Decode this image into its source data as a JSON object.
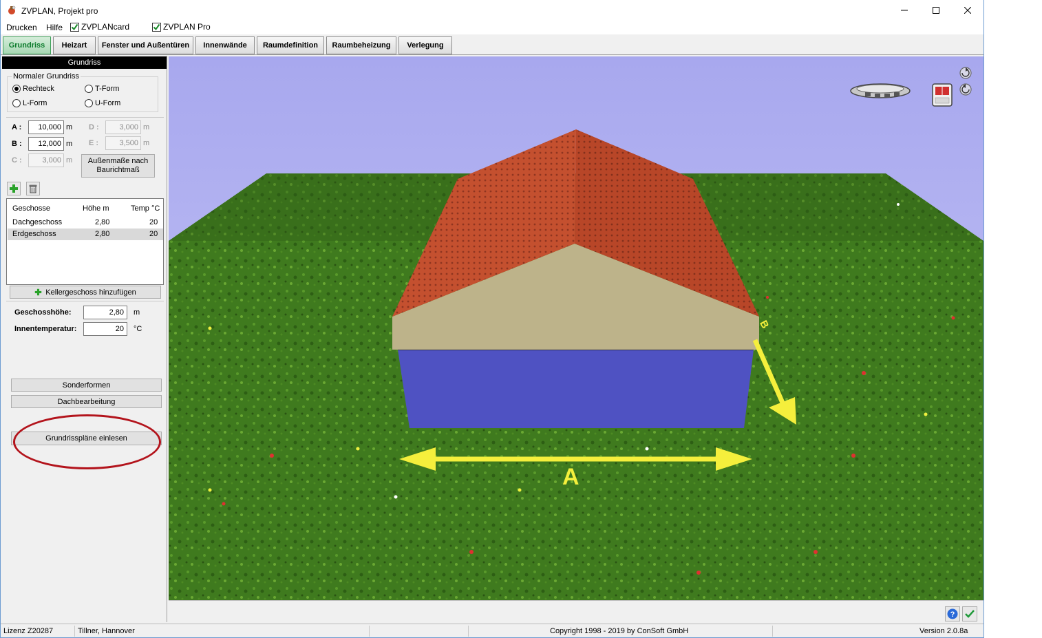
{
  "window": {
    "title": "ZVPLAN, Projekt pro"
  },
  "menu": {
    "items": [
      "Drucken",
      "Hilfe"
    ],
    "checks": [
      {
        "label": "ZVPLANcard",
        "checked": true
      },
      {
        "label": "ZVPLAN Pro",
        "checked": true
      }
    ]
  },
  "tabs": [
    {
      "label": "Grundriss",
      "active": true
    },
    {
      "label": "Heizart",
      "active": false
    },
    {
      "label": "Fenster und Außentüren",
      "active": false
    },
    {
      "label": "Innenwände",
      "active": false
    },
    {
      "label": "Raumdefinition",
      "active": false
    },
    {
      "label": "Raumbeheizung",
      "active": false
    },
    {
      "label": "Verlegung",
      "active": false
    }
  ],
  "panel": {
    "header": "Grundriss",
    "shape_group_label": "Normaler Grundriss",
    "shapes": [
      {
        "label": "Rechteck",
        "selected": true
      },
      {
        "label": "T-Form",
        "selected": false
      },
      {
        "label": "L-Form",
        "selected": false
      },
      {
        "label": "U-Form",
        "selected": false
      }
    ],
    "dimensions": {
      "A": {
        "label": "A :",
        "value": "10,000",
        "unit": "m",
        "enabled": true
      },
      "B": {
        "label": "B :",
        "value": "12,000",
        "unit": "m",
        "enabled": true
      },
      "C": {
        "label": "C :",
        "value": "3,000",
        "unit": "m",
        "enabled": false
      },
      "D": {
        "label": "D :",
        "value": "3,000",
        "unit": "m",
        "enabled": false
      },
      "E": {
        "label": "E :",
        "value": "3,500",
        "unit": "m",
        "enabled": false
      }
    },
    "outer_dims_button_line1": "Außenmaße nach",
    "outer_dims_button_line2": "Baurichtmaß",
    "table": {
      "headers": [
        "Geschosse",
        "Höhe m",
        "Temp °C"
      ],
      "rows": [
        {
          "name": "Dachgeschoss",
          "height": "2,80",
          "temp": "20",
          "selected": false
        },
        {
          "name": "Erdgeschoss",
          "height": "2,80",
          "temp": "20",
          "selected": true
        }
      ]
    },
    "add_basement_label": "Kellergeschoss hinzufügen",
    "floor_height": {
      "label": "Geschosshöhe:",
      "value": "2,80",
      "unit": "m"
    },
    "inner_temp": {
      "label": "Innentemperatur:",
      "value": "20",
      "unit": "°C"
    },
    "special_forms_label": "Sonderformen",
    "roof_edit_label": "Dachbearbeitung",
    "import_plans_label": "Grundrisspläne einlesen"
  },
  "viewport": {
    "label_a": "A",
    "label_b": "B",
    "colors": {
      "sky": "#b8b8f4",
      "grass": "#3f7a1e",
      "roof": "#c4502f",
      "gable": "#bdb38a",
      "wall": "#4f52c2",
      "arrow": "#f5ef3c"
    }
  },
  "statusbar": {
    "license": "Lizenz Z20287",
    "user": "Tillner, Hannover",
    "copyright": "Copyright 1998 - 2019 by ConSoft GmbH",
    "version": "Version 2.0.8a"
  }
}
